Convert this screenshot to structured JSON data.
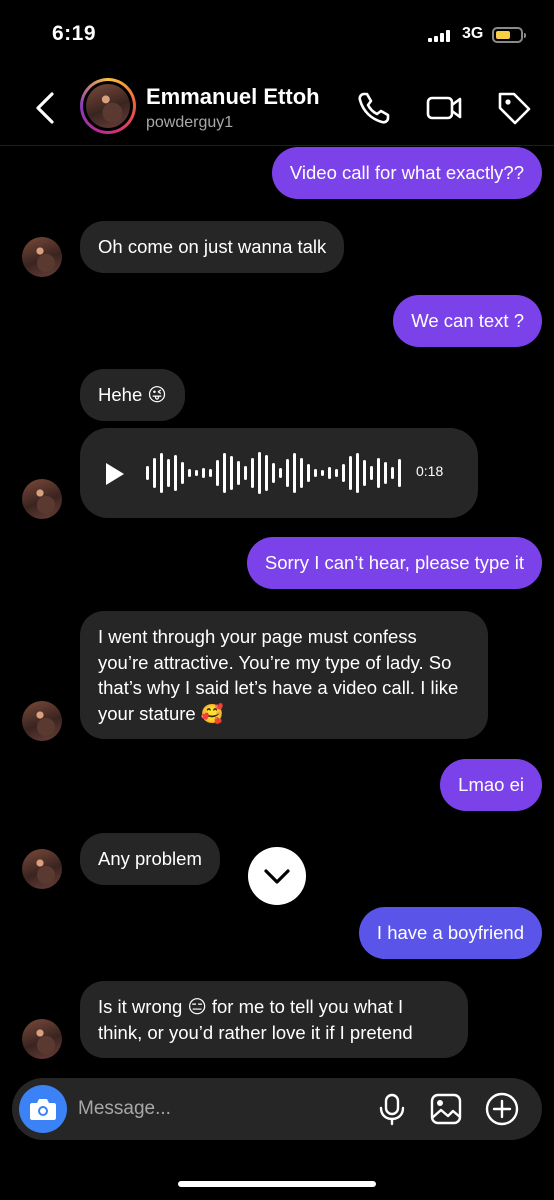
{
  "status_bar": {
    "time": "6:19",
    "network": "3G"
  },
  "header": {
    "name": "Emmanuel Ettoh",
    "username": "powderguy1"
  },
  "messages": [
    {
      "side": "out",
      "text": "Video call for what exactly??"
    },
    {
      "side": "in",
      "text": "Oh come on just wanna talk"
    },
    {
      "side": "out",
      "text": "We can text ?"
    },
    {
      "side": "in",
      "text": "Hehe 😜"
    },
    {
      "side": "in",
      "type": "voice",
      "duration": "0:18"
    },
    {
      "side": "out",
      "text": "Sorry I can’t hear, please type it"
    },
    {
      "side": "in",
      "text": "I went through your page must confess you’re attractive. You’re my type of lady. So that’s why I said let’s have a video call. I like your stature 🥰"
    },
    {
      "side": "out",
      "text": "Lmao ei"
    },
    {
      "side": "in",
      "text": "Any problem"
    },
    {
      "side": "out",
      "text": "I have a boyfriend"
    },
    {
      "side": "in",
      "text": "Is it wrong 😑 for me to tell you what I think, or you’d rather love it if I pretend"
    }
  ],
  "composer": {
    "placeholder": "Message..."
  },
  "icons": {
    "back": "chevron-left-icon",
    "call": "phone-icon",
    "video": "video-camera-icon",
    "tag": "tag-icon",
    "camera": "camera-icon",
    "mic": "microphone-icon",
    "gallery": "image-icon",
    "add": "plus-circle-icon",
    "play": "play-icon",
    "scroll": "chevron-down-icon"
  },
  "colors": {
    "outgoing": "#7b42ea",
    "outgoing_late": "#5a55e8",
    "incoming": "#262626",
    "camera_button": "#3b82f6",
    "battery": "#f7ce46"
  }
}
